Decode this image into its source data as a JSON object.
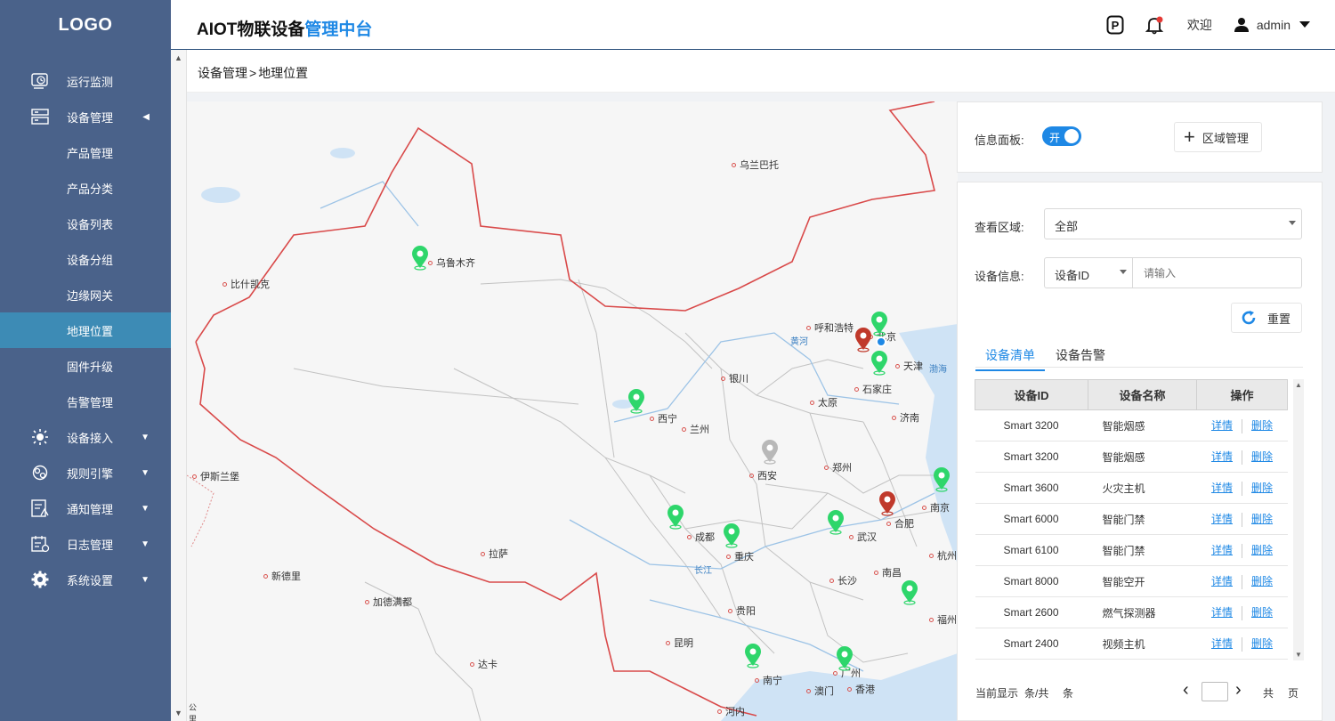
{
  "app": {
    "logo": "LOGO",
    "title_main": "AIOT物联设备",
    "title_highlight": "管理中台",
    "welcome": "欢迎",
    "username": "admin"
  },
  "sidebar": {
    "items": [
      {
        "label": "运行监测",
        "icon": "monitor-icon",
        "caret": ""
      },
      {
        "label": "设备管理",
        "icon": "device-manage-icon",
        "caret": "◀"
      },
      {
        "label": "产品管理",
        "icon": "",
        "caret": ""
      },
      {
        "label": "产品分类",
        "icon": "",
        "caret": ""
      },
      {
        "label": "设备列表",
        "icon": "",
        "caret": ""
      },
      {
        "label": "设备分组",
        "icon": "",
        "caret": ""
      },
      {
        "label": "边缘网关",
        "icon": "",
        "caret": ""
      },
      {
        "label": "地理位置",
        "icon": "",
        "caret": ""
      },
      {
        "label": "固件升级",
        "icon": "",
        "caret": ""
      },
      {
        "label": "告警管理",
        "icon": "",
        "caret": ""
      },
      {
        "label": "设备接入",
        "icon": "device-access-icon",
        "caret": "▼"
      },
      {
        "label": "规则引擎",
        "icon": "rule-engine-icon",
        "caret": "▼"
      },
      {
        "label": "通知管理",
        "icon": "notification-icon",
        "caret": "▼"
      },
      {
        "label": "日志管理",
        "icon": "log-icon",
        "caret": "▼"
      },
      {
        "label": "系统设置",
        "icon": "gear-icon",
        "caret": "▼"
      }
    ]
  },
  "breadcrumb": {
    "parent": "设备管理",
    "sep": ">",
    "current": "地理位置"
  },
  "map": {
    "cities": [
      "乌兰巴托",
      "乌鲁木齐",
      "比什凯克",
      "呼和浩特",
      "北京",
      "天津",
      "银川",
      "石家庄",
      "太原",
      "西宁",
      "兰州",
      "济南",
      "伊斯兰堡",
      "西安",
      "郑州",
      "南京",
      "合肥",
      "成都",
      "重庆",
      "武汉",
      "拉萨",
      "杭州",
      "新德里",
      "长沙",
      "南昌",
      "加德满都",
      "贵阳",
      "福州",
      "昆明",
      "达卡",
      "南宁",
      "广州",
      "澳门",
      "香港",
      "河内"
    ],
    "rivers": [
      "黄河",
      "长江"
    ],
    "sea": "渤海",
    "scale": "公里"
  },
  "panel": {
    "info_label": "信息面板:",
    "toggle_text": "开",
    "area_button": "区域管理",
    "view_area_label": "查看区域:",
    "view_area_value": "全部",
    "device_info_label": "设备信息:",
    "device_field_value": "设备ID",
    "device_placeholder": "请输入",
    "reset_button": "重置",
    "tabs": [
      "设备清单",
      "设备告警"
    ],
    "columns": [
      "设备ID",
      "设备名称",
      "操作"
    ],
    "rows": [
      {
        "id": "Smart 3200",
        "name": "智能烟感"
      },
      {
        "id": "Smart 3200",
        "name": "智能烟感"
      },
      {
        "id": "Smart 3600",
        "name": "火灾主机"
      },
      {
        "id": "Smart 6000",
        "name": "智能门禁"
      },
      {
        "id": "Smart 6100",
        "name": "智能门禁"
      },
      {
        "id": "Smart 8000",
        "name": "智能空开"
      },
      {
        "id": "Smart 2600",
        "name": "燃气探测器"
      },
      {
        "id": "Smart 2400",
        "name": "视频主机"
      }
    ],
    "action_detail": "详情",
    "action_delete": "删除",
    "footer_display": "当前显示",
    "footer_count": "条/共",
    "footer_unit": "条",
    "footer_total": "共",
    "footer_page": "页"
  },
  "colors": {
    "sidebar": "#4a628a",
    "active": "#3d8bb5",
    "accent": "#1e88e5",
    "pin_green": "#2ed66b",
    "pin_red": "#c0392b",
    "pin_gray": "#b8b8b8",
    "border_red": "#d94a4a"
  }
}
